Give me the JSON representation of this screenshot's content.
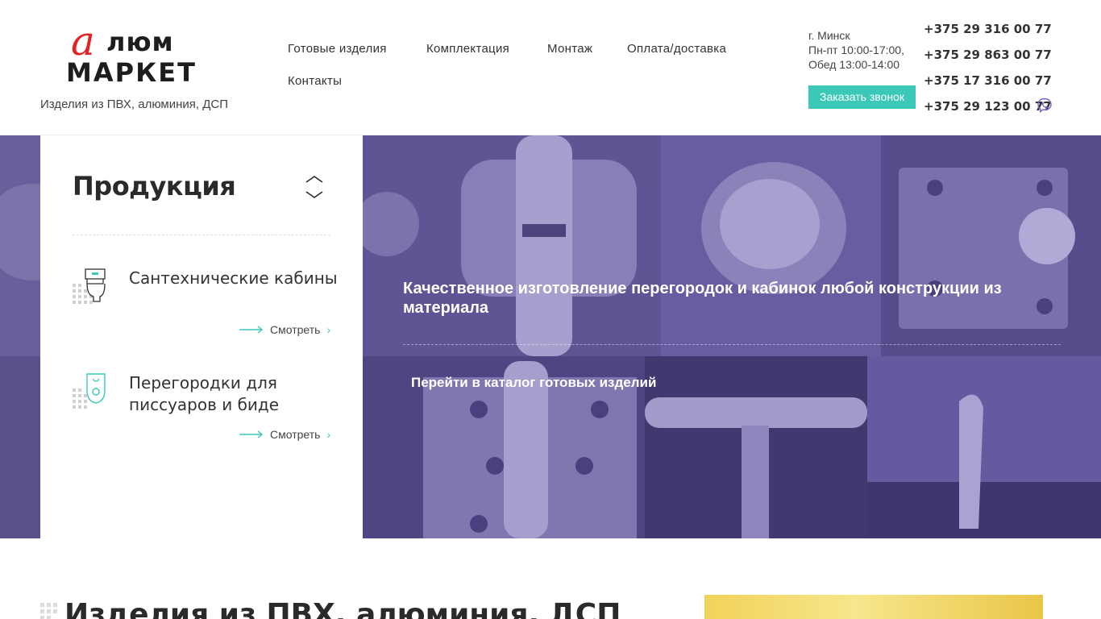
{
  "logo": {
    "mark_letter": "а",
    "line1": "люм",
    "line2": "МАРКЕТ"
  },
  "tagline": "Изделия из ПВХ, алюминия, ДСП",
  "nav": [
    "Готовые изделия",
    "Комплектация",
    "Монтаж",
    "Оплата/доставка",
    "Контакты"
  ],
  "contact": {
    "city": "г. Минск",
    "hours": "Пн-пт 10:00-17:00,",
    "lunch": "Обед 13:00-14:00",
    "callback": "Заказать звонок"
  },
  "phones": [
    "+375 29 316 00 77",
    "+375 29 863 00 77",
    "+375 17 316 00 77",
    "+375 29 123 00 77"
  ],
  "hero": {
    "title": "Качественное изготовление перегородок и кабинок любой конструкции из материала",
    "catalog_link": "Перейти в каталог готовых изделий"
  },
  "panel": {
    "title": "Продукция",
    "items": [
      {
        "name": "Сантехнические кабины",
        "see": "Смотреть"
      },
      {
        "name": "Перегородки для писсуаров и биде",
        "see": "Смотреть"
      }
    ]
  },
  "bottom": {
    "title": "Изделия из ПВХ, алюминия, ДСП"
  },
  "colors": {
    "accent": "#3cc8b8",
    "brand_red": "#e32227",
    "hero_overlay": "#5b4f8c",
    "viber": "#7b5fd1"
  },
  "icons": [
    "toilet-icon",
    "urinal-icon",
    "viber-icon",
    "chevron-up-down-icon",
    "arrow-right-icon"
  ]
}
